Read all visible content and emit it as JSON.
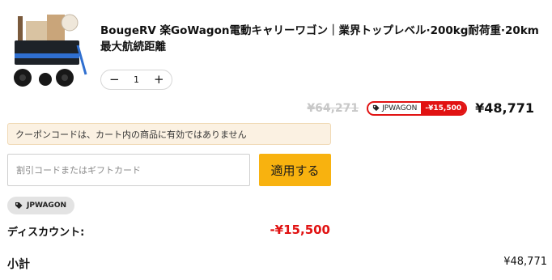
{
  "cart_item": {
    "title": "BougeRV 楽GoWagon電動キャリーワゴン｜業界トップレベル·200kg耐荷重·20km最大航続距離",
    "quantity": "1",
    "qty_minus": "−",
    "qty_plus": "+",
    "original_price": "¥64,271",
    "discount_badge": {
      "code": "JPWAGON",
      "amount": "-¥15,500"
    },
    "price": "¥48,771"
  },
  "coupon": {
    "notice": "クーポンコードは、カート内の商品に有効ではありません",
    "input_value": "",
    "input_placeholder": "割引コードまたはギフトカード",
    "apply_label": "適用する",
    "applied_tag": "JPWAGON"
  },
  "summary": {
    "discount_label": "ディスカウント:",
    "discount_value": "-¥15,500",
    "subtotal_label": "小計",
    "subtotal_value": "¥48,771"
  },
  "colors": {
    "accent_button": "#f8b20f",
    "discount_red": "#e11212",
    "notice_bg": "#fbf1e2"
  }
}
